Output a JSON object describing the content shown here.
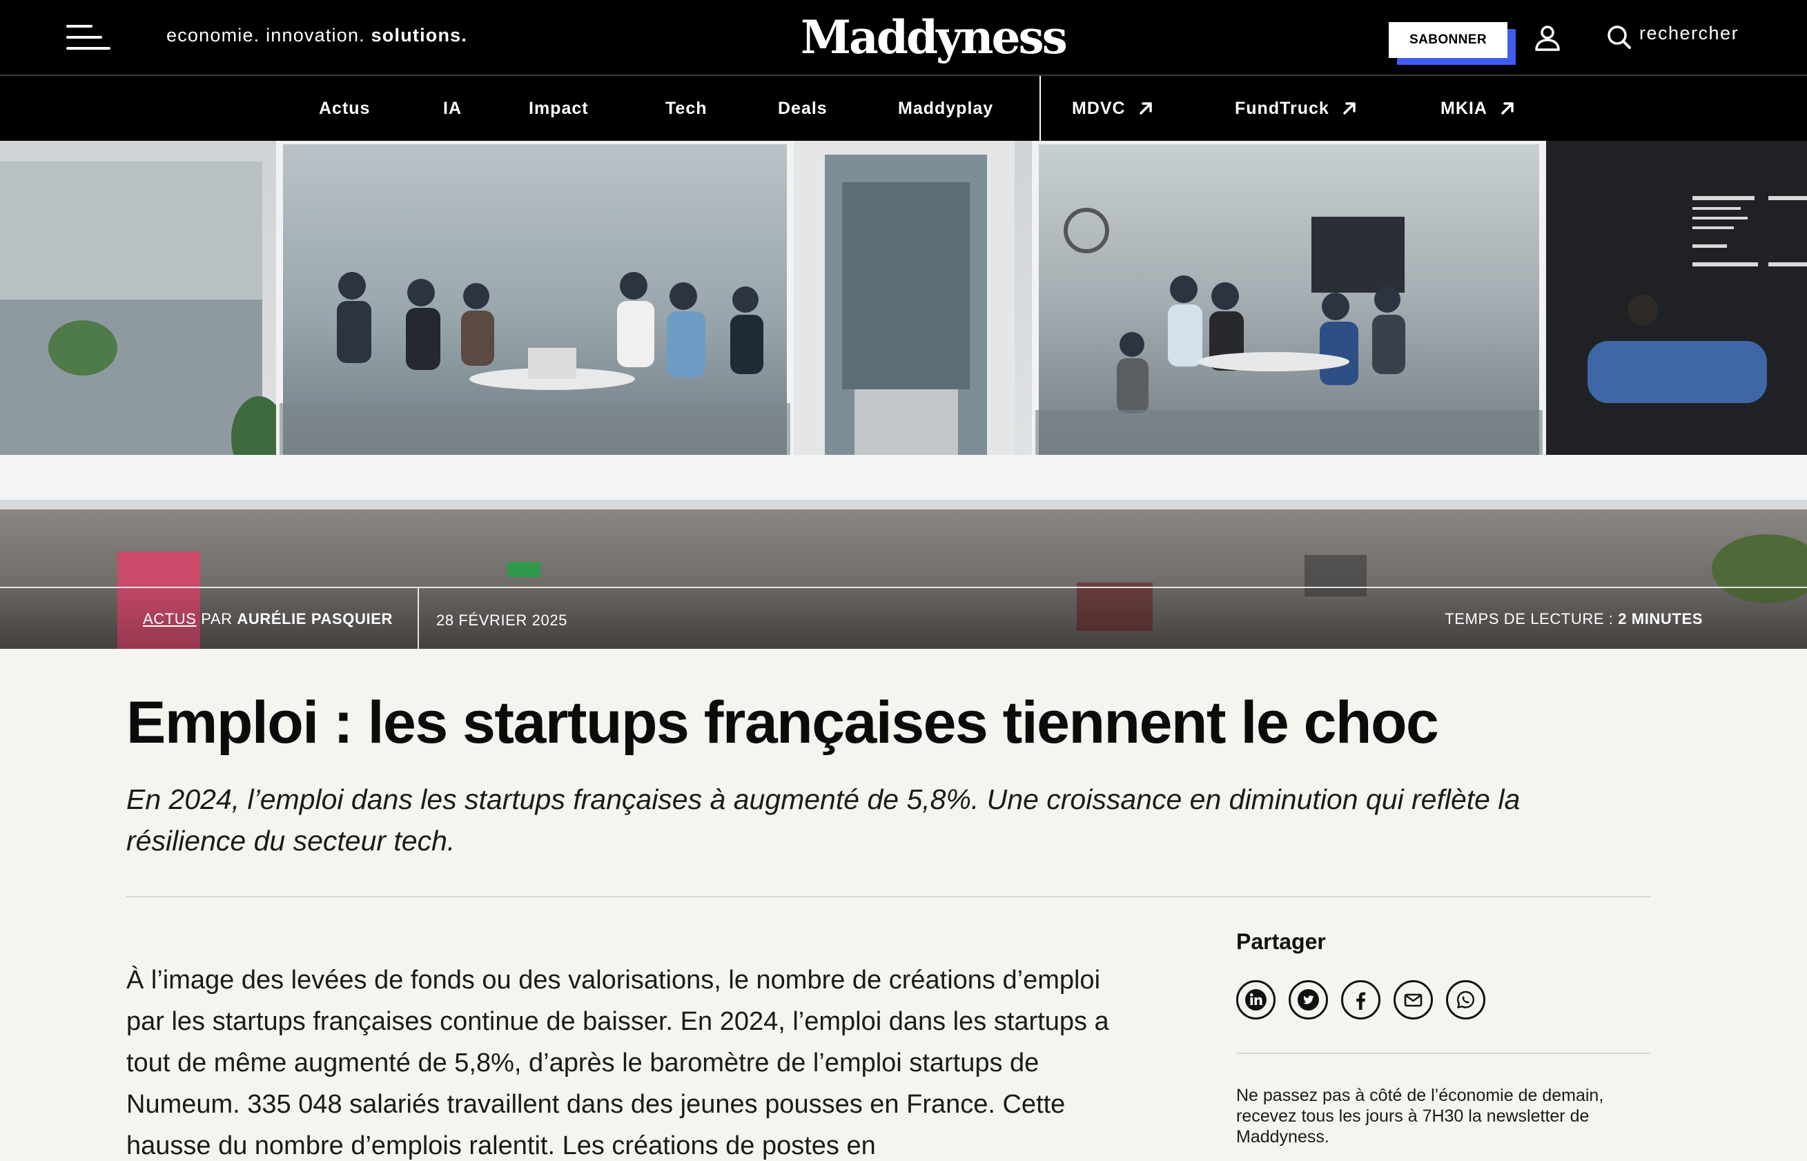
{
  "header": {
    "tagline_prefix": "economie. innovation.",
    "tagline_bold": "solutions.",
    "logo": "Maddyness",
    "subscribe_label": "SABONNER",
    "search_label": "rechercher",
    "accent_color": "#3f5cf0"
  },
  "nav": {
    "items": [
      {
        "label": "Actus"
      },
      {
        "label": "IA"
      },
      {
        "label": "Impact"
      },
      {
        "label": "Tech"
      },
      {
        "label": "Deals"
      },
      {
        "label": "Maddyplay"
      },
      {
        "label": "MDVC",
        "icon": "arrow-up-right-icon"
      },
      {
        "label": "FundTruck",
        "icon": "arrow-up-right-icon"
      },
      {
        "label": "MKIA",
        "icon": "arrow-up-right-icon"
      }
    ]
  },
  "hero": {
    "image": "photo of people working in glass-walled meeting rooms at an office",
    "category": "ACTUS",
    "by": "PAR",
    "author": "AURÉLIE PASQUIER",
    "date": "28 FÉVRIER 2025",
    "reading_time_label": "TEMPS DE LECTURE :",
    "reading_time_value": "2 MINUTES"
  },
  "article": {
    "title": "Emploi : les startups françaises tiennent le choc",
    "lead": "En 2024, l’emploi dans les startups françaises à augmenté de 5,8%. Une croissance en diminution qui reflète la résilience du secteur tech.",
    "body": "À l’image des levées de fonds ou des valorisations, le nombre de créations d’emploi par les startups françaises continue de baisser. En 2024, l’emploi dans les startups a tout de même augmenté de 5,8%, d’après le baromètre de l’emploi startups de Numeum. 335 048 salariés travaillent dans des jeunes pousses en France. Cette hausse du nombre d’emplois ralentit. Les créations de postes en"
  },
  "sidebar": {
    "share_title": "Partager",
    "share_icons": [
      "linkedin-icon",
      "twitter-icon",
      "facebook-icon",
      "email-icon",
      "whatsapp-icon"
    ],
    "newsletter_text": "Ne passez pas à côté de l’économie de demain, recevez tous les jours à 7H30 la newsletter de Maddyness."
  }
}
